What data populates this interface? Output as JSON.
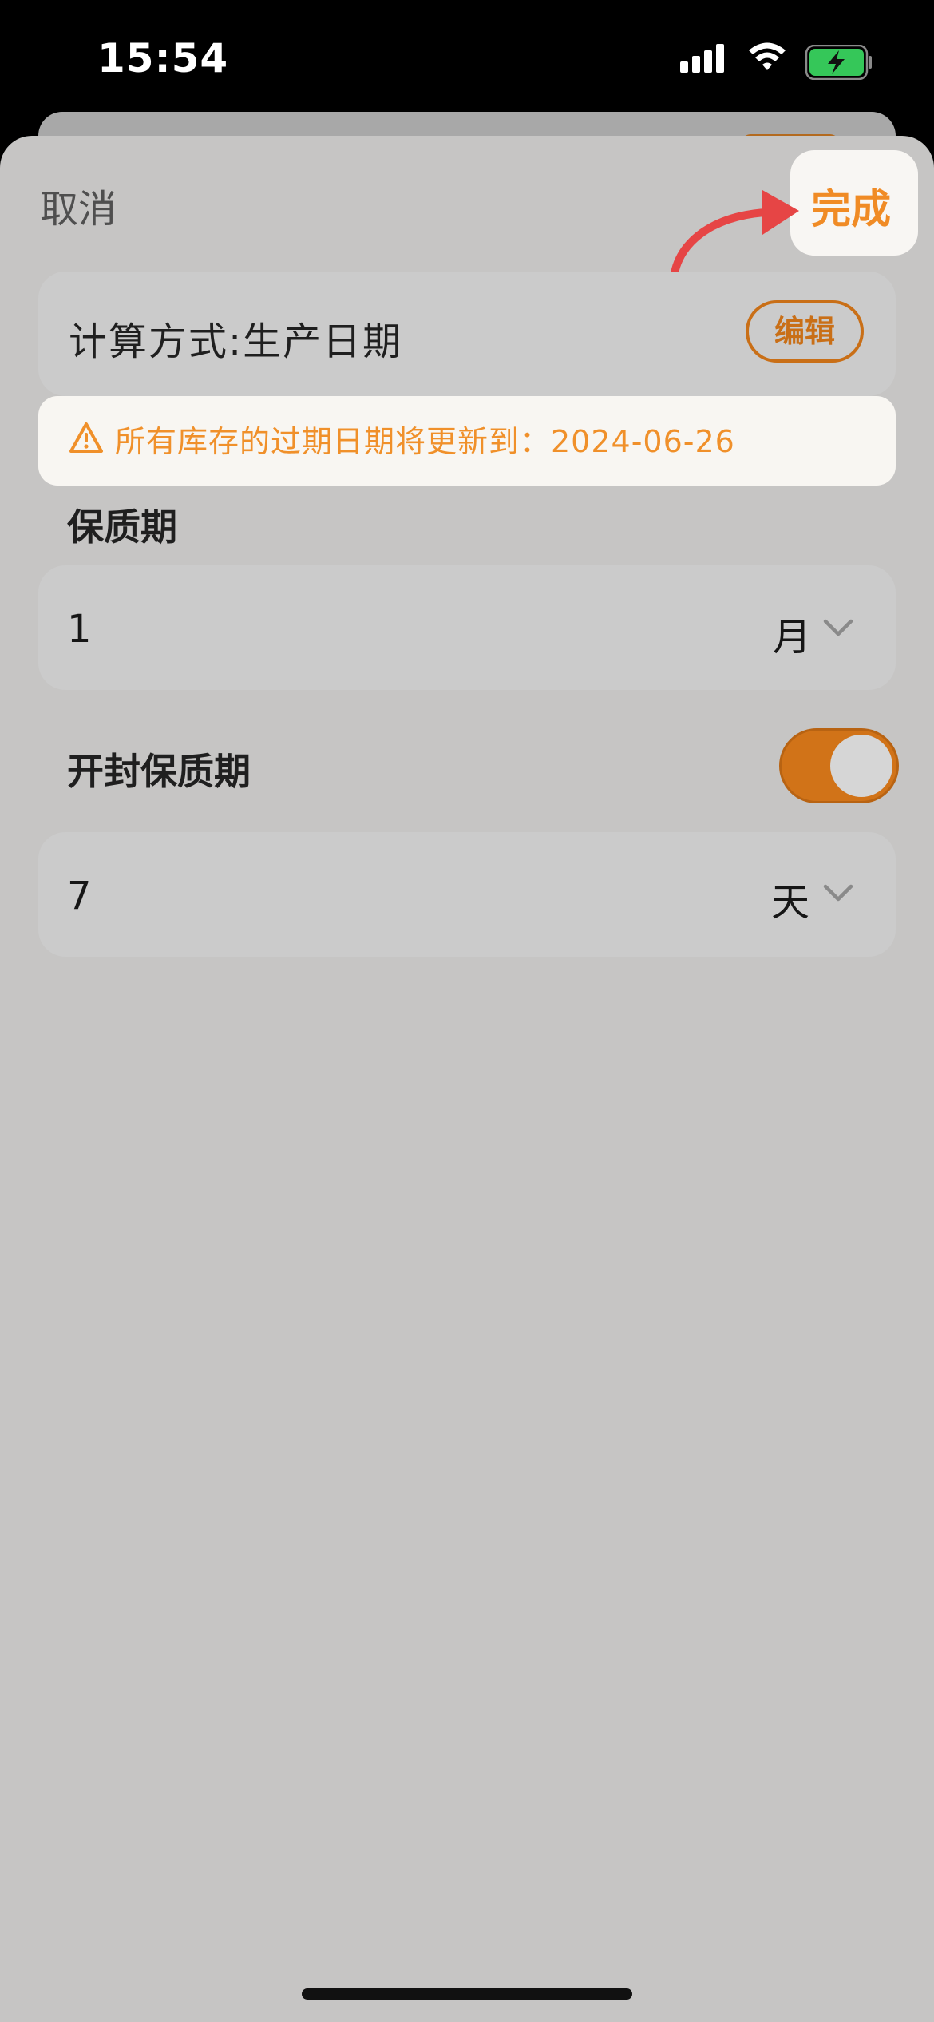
{
  "status_bar": {
    "time": "15:54",
    "icons": [
      "signal-icon",
      "wifi-icon",
      "battery-charging-icon"
    ]
  },
  "header": {
    "cancel_label": "取消",
    "done_label": "完成"
  },
  "calculation": {
    "label": "计算方式:生产日期",
    "edit_label": "编辑"
  },
  "notice": {
    "icon": "warning-icon",
    "text": "所有库存的过期日期将更新到：2024-06-26"
  },
  "shelf_life": {
    "title": "保质期",
    "value": "1",
    "unit": "月",
    "chevron": "chevron-down-icon"
  },
  "opened_shelf_life": {
    "title": "开封保质期",
    "enabled": true,
    "value": "7",
    "unit": "天",
    "chevron": "chevron-down-icon"
  },
  "colors": {
    "accent": "#f08b25",
    "toggle_on": "#d17318",
    "sheet_background": "#c6c5c4",
    "card_background": "#cbcbcb"
  }
}
